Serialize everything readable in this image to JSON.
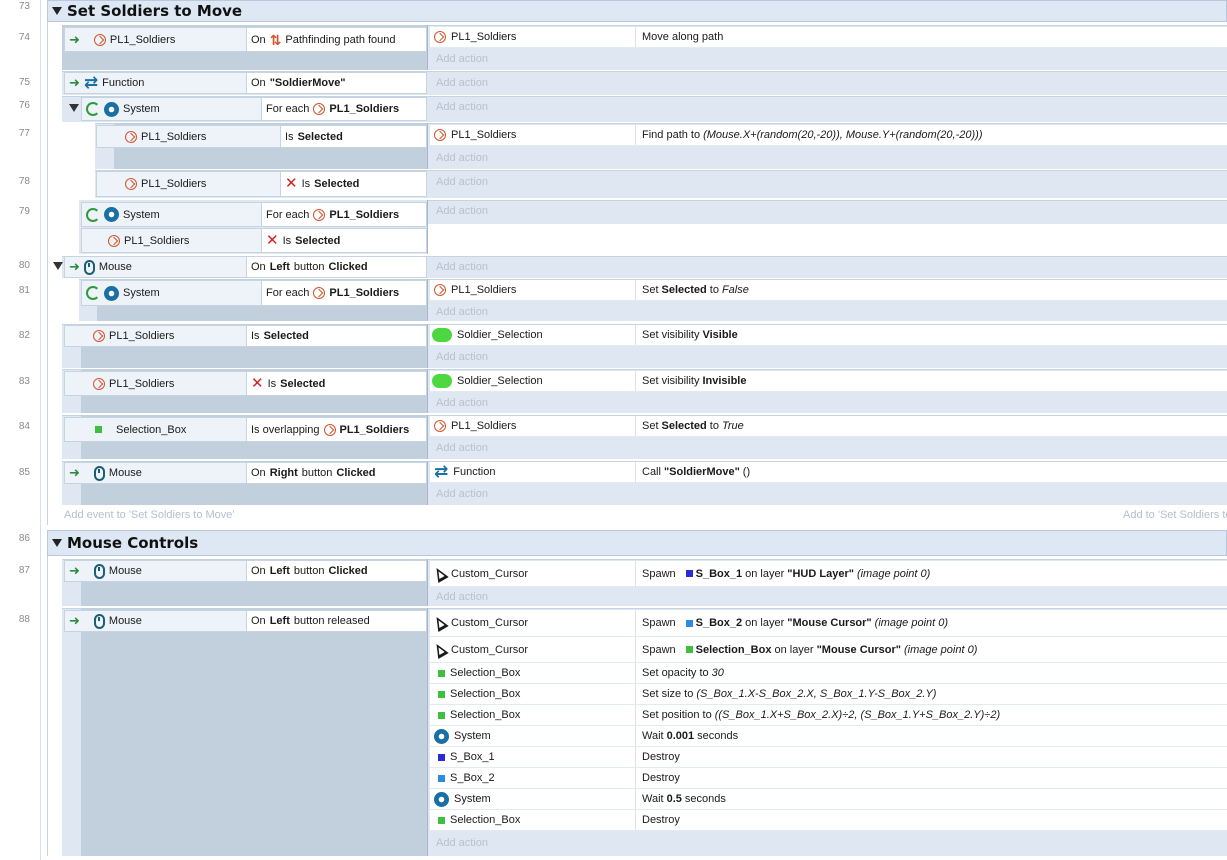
{
  "groups": [
    {
      "line": "73",
      "title": "Set Soldiers to Move"
    },
    {
      "line": "86",
      "title": "Mouse Controls"
    }
  ],
  "events": {
    "e74": {
      "line": "74",
      "obj": "PL1_Soldiers",
      "on": "On",
      "cond": "Pathfinding path found",
      "actions": [
        {
          "obj": "PL1_Soldiers",
          "text": "Move along path"
        }
      ],
      "add": "Add action"
    },
    "e75": {
      "line": "75",
      "obj": "Function",
      "cond_pre": "On",
      "cond_b": "\"SoldierMove\"",
      "add": "Add action"
    },
    "e76": {
      "line": "76",
      "obj": "System",
      "cond_pre": "For each",
      "cond_b": "PL1_Soldiers",
      "add": "Add action"
    },
    "e77": {
      "line": "77",
      "obj": "PL1_Soldiers",
      "cond_pre": "Is",
      "cond_b": "Selected",
      "act_obj": "PL1_Soldiers",
      "act_pre": "Find path to",
      "act_i": "(Mouse.X+(random(20,-20)), Mouse.Y+(random(20,-20)))",
      "add": "Add action"
    },
    "e78": {
      "line": "78",
      "obj": "PL1_Soldiers",
      "cond_pre": "Is",
      "cond_b": "Selected",
      "add": "Add action"
    },
    "e79": {
      "line": "79",
      "obj": "System",
      "cond_pre": "For each",
      "cond_b": "PL1_Soldiers",
      "obj2": "PL1_Soldiers",
      "cond2_pre": "Is",
      "cond2_b": "Selected",
      "add": "Add action"
    },
    "e80": {
      "line": "80",
      "obj": "Mouse",
      "cond_pre": "On",
      "cond_b": "Left",
      "cond_mid": "button",
      "cond_b2": "Clicked",
      "add": "Add action"
    },
    "e81": {
      "line": "81",
      "obj": "System",
      "cond_pre": "For each",
      "cond_b": "PL1_Soldiers",
      "act_obj": "PL1_Soldiers",
      "act_pre": "Set",
      "act_b": "Selected",
      "act_mid": "to",
      "act_i": "False",
      "add": "Add action"
    },
    "e82": {
      "line": "82",
      "obj": "PL1_Soldiers",
      "cond_pre": "Is",
      "cond_b": "Selected",
      "act_obj": "Soldier_Selection",
      "act_pre": "Set visibility",
      "act_b": "Visible",
      "add": "Add action"
    },
    "e83": {
      "line": "83",
      "obj": "PL1_Soldiers",
      "cond_pre": "Is",
      "cond_b": "Selected",
      "act_obj": "Soldier_Selection",
      "act_pre": "Set visibility",
      "act_b": "Invisible",
      "add": "Add action"
    },
    "e84": {
      "line": "84",
      "obj": "Selection_Box",
      "cond_pre": "Is overlapping",
      "cond_b": "PL1_Soldiers",
      "act_obj": "PL1_Soldiers",
      "act_pre": "Set",
      "act_b": "Selected",
      "act_mid": "to",
      "act_i": "True",
      "add": "Add action"
    },
    "e85": {
      "line": "85",
      "obj": "Mouse",
      "cond_pre": "On",
      "cond_b": "Right",
      "cond_mid": "button",
      "cond_b2": "Clicked",
      "act_obj": "Function",
      "act_pre": "Call",
      "act_b": "\"SoldierMove\"",
      "act_post": "()",
      "add": "Add action"
    },
    "e87": {
      "line": "87",
      "obj": "Mouse",
      "cond_pre": "On",
      "cond_b": "Left",
      "cond_mid": "button",
      "cond_b2": "Clicked",
      "act_obj": "Custom_Cursor",
      "act_pre": "Spawn",
      "act_b": "S_Box_1",
      "act_mid": "on layer",
      "act_b2": "\"HUD Layer\"",
      "act_i": "(image point 0)",
      "add": "Add action"
    },
    "e88": {
      "line": "88",
      "obj": "Mouse",
      "cond_pre": "On",
      "cond_b": "Left",
      "cond_mid": "button released",
      "add": "Add action",
      "a1": {
        "obj": "Custom_Cursor",
        "pre": "Spawn",
        "b": "S_Box_2",
        "mid": "on layer",
        "b2": "\"Mouse Cursor\"",
        "i": "(image point 0)"
      },
      "a2": {
        "obj": "Custom_Cursor",
        "pre": "Spawn",
        "b": "Selection_Box",
        "mid": "on layer",
        "b2": "\"Mouse Cursor\"",
        "i": "(image point 0)"
      },
      "a3": {
        "obj": "Selection_Box",
        "pre": "Set opacity to",
        "i": "30"
      },
      "a4": {
        "obj": "Selection_Box",
        "pre": "Set size to",
        "i": "(S_Box_1.X-S_Box_2.X, S_Box_1.Y-S_Box_2.Y)"
      },
      "a5": {
        "obj": "Selection_Box",
        "pre": "Set position to",
        "i": "((S_Box_1.X+S_Box_2.X)÷2, (S_Box_1.Y+S_Box_2.Y)÷2)"
      },
      "a6": {
        "obj": "System",
        "pre": "Wait",
        "b": "0.001",
        "post": "seconds"
      },
      "a7": {
        "obj": "S_Box_1",
        "text": "Destroy"
      },
      "a8": {
        "obj": "S_Box_2",
        "text": "Destroy"
      },
      "a9": {
        "obj": "System",
        "pre": "Wait",
        "b": "0.5",
        "post": "seconds"
      },
      "a10": {
        "obj": "Selection_Box",
        "text": "Destroy"
      }
    }
  },
  "hints": {
    "add_event": "Add event to 'Set Soldiers to Move'",
    "add_to": "Add to 'Set Soldiers to"
  },
  "colors": {
    "sprite": "#d2542c",
    "green_square": "#3fbf3f",
    "blue_square": "#2b2bd6",
    "light_blue_square": "#2d8be0",
    "pill": "#4ed840",
    "arrow": "#2e8b3a",
    "invert_x": "#d42222"
  }
}
